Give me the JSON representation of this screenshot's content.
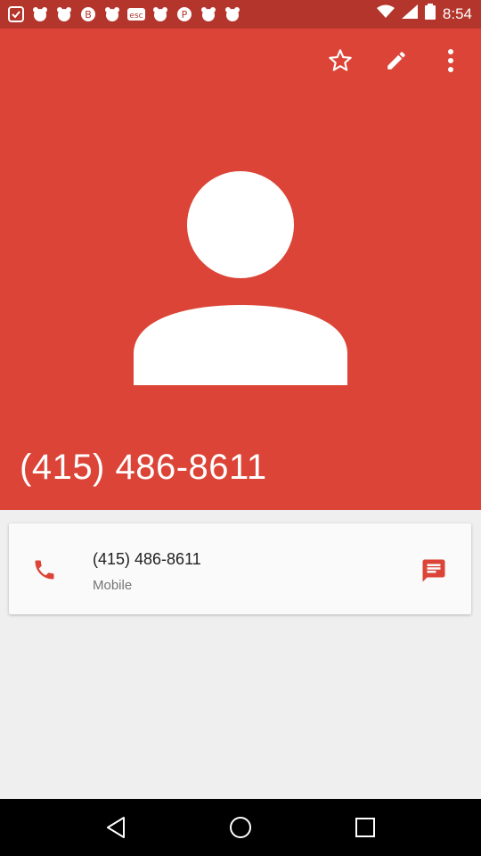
{
  "status_bar": {
    "time": "8:54",
    "notification_icons": [
      "app-icon-1",
      "app-icon-2",
      "app-icon-3",
      "bitcoin-icon",
      "app-icon-4",
      "esc-icon",
      "app-icon-5",
      "pinterest-icon",
      "app-icon-6",
      "app-icon-7"
    ]
  },
  "header": {
    "background": "#db4437",
    "title": "(415) 486-8611",
    "actions": [
      "favorite-star-icon",
      "edit-pencil-icon",
      "more-options-icon"
    ]
  },
  "contact_card": {
    "number": "(415) 486-8611",
    "type": "Mobile",
    "accent": "#db4437"
  },
  "nav_bar": {
    "buttons": [
      "back",
      "home",
      "recents"
    ]
  }
}
